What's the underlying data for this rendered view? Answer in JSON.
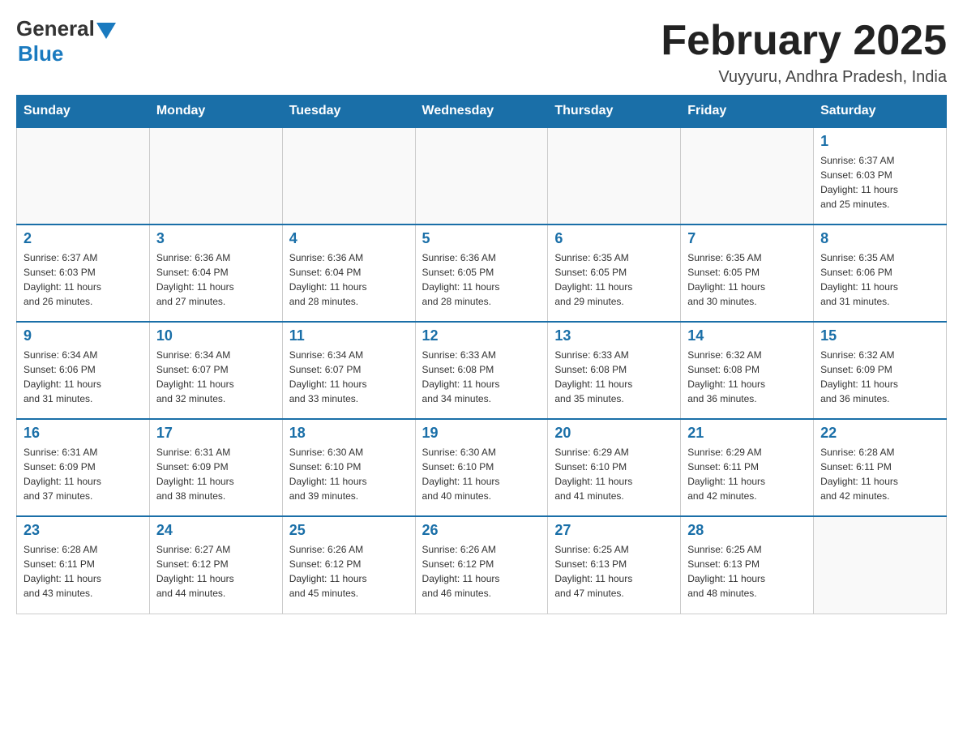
{
  "header": {
    "logo_general": "General",
    "logo_blue": "Blue",
    "title": "February 2025",
    "location": "Vuyyuru, Andhra Pradesh, India"
  },
  "weekdays": [
    "Sunday",
    "Monday",
    "Tuesday",
    "Wednesday",
    "Thursday",
    "Friday",
    "Saturday"
  ],
  "weeks": [
    [
      {
        "day": "",
        "info": ""
      },
      {
        "day": "",
        "info": ""
      },
      {
        "day": "",
        "info": ""
      },
      {
        "day": "",
        "info": ""
      },
      {
        "day": "",
        "info": ""
      },
      {
        "day": "",
        "info": ""
      },
      {
        "day": "1",
        "info": "Sunrise: 6:37 AM\nSunset: 6:03 PM\nDaylight: 11 hours\nand 25 minutes."
      }
    ],
    [
      {
        "day": "2",
        "info": "Sunrise: 6:37 AM\nSunset: 6:03 PM\nDaylight: 11 hours\nand 26 minutes."
      },
      {
        "day": "3",
        "info": "Sunrise: 6:36 AM\nSunset: 6:04 PM\nDaylight: 11 hours\nand 27 minutes."
      },
      {
        "day": "4",
        "info": "Sunrise: 6:36 AM\nSunset: 6:04 PM\nDaylight: 11 hours\nand 28 minutes."
      },
      {
        "day": "5",
        "info": "Sunrise: 6:36 AM\nSunset: 6:05 PM\nDaylight: 11 hours\nand 28 minutes."
      },
      {
        "day": "6",
        "info": "Sunrise: 6:35 AM\nSunset: 6:05 PM\nDaylight: 11 hours\nand 29 minutes."
      },
      {
        "day": "7",
        "info": "Sunrise: 6:35 AM\nSunset: 6:05 PM\nDaylight: 11 hours\nand 30 minutes."
      },
      {
        "day": "8",
        "info": "Sunrise: 6:35 AM\nSunset: 6:06 PM\nDaylight: 11 hours\nand 31 minutes."
      }
    ],
    [
      {
        "day": "9",
        "info": "Sunrise: 6:34 AM\nSunset: 6:06 PM\nDaylight: 11 hours\nand 31 minutes."
      },
      {
        "day": "10",
        "info": "Sunrise: 6:34 AM\nSunset: 6:07 PM\nDaylight: 11 hours\nand 32 minutes."
      },
      {
        "day": "11",
        "info": "Sunrise: 6:34 AM\nSunset: 6:07 PM\nDaylight: 11 hours\nand 33 minutes."
      },
      {
        "day": "12",
        "info": "Sunrise: 6:33 AM\nSunset: 6:08 PM\nDaylight: 11 hours\nand 34 minutes."
      },
      {
        "day": "13",
        "info": "Sunrise: 6:33 AM\nSunset: 6:08 PM\nDaylight: 11 hours\nand 35 minutes."
      },
      {
        "day": "14",
        "info": "Sunrise: 6:32 AM\nSunset: 6:08 PM\nDaylight: 11 hours\nand 36 minutes."
      },
      {
        "day": "15",
        "info": "Sunrise: 6:32 AM\nSunset: 6:09 PM\nDaylight: 11 hours\nand 36 minutes."
      }
    ],
    [
      {
        "day": "16",
        "info": "Sunrise: 6:31 AM\nSunset: 6:09 PM\nDaylight: 11 hours\nand 37 minutes."
      },
      {
        "day": "17",
        "info": "Sunrise: 6:31 AM\nSunset: 6:09 PM\nDaylight: 11 hours\nand 38 minutes."
      },
      {
        "day": "18",
        "info": "Sunrise: 6:30 AM\nSunset: 6:10 PM\nDaylight: 11 hours\nand 39 minutes."
      },
      {
        "day": "19",
        "info": "Sunrise: 6:30 AM\nSunset: 6:10 PM\nDaylight: 11 hours\nand 40 minutes."
      },
      {
        "day": "20",
        "info": "Sunrise: 6:29 AM\nSunset: 6:10 PM\nDaylight: 11 hours\nand 41 minutes."
      },
      {
        "day": "21",
        "info": "Sunrise: 6:29 AM\nSunset: 6:11 PM\nDaylight: 11 hours\nand 42 minutes."
      },
      {
        "day": "22",
        "info": "Sunrise: 6:28 AM\nSunset: 6:11 PM\nDaylight: 11 hours\nand 42 minutes."
      }
    ],
    [
      {
        "day": "23",
        "info": "Sunrise: 6:28 AM\nSunset: 6:11 PM\nDaylight: 11 hours\nand 43 minutes."
      },
      {
        "day": "24",
        "info": "Sunrise: 6:27 AM\nSunset: 6:12 PM\nDaylight: 11 hours\nand 44 minutes."
      },
      {
        "day": "25",
        "info": "Sunrise: 6:26 AM\nSunset: 6:12 PM\nDaylight: 11 hours\nand 45 minutes."
      },
      {
        "day": "26",
        "info": "Sunrise: 6:26 AM\nSunset: 6:12 PM\nDaylight: 11 hours\nand 46 minutes."
      },
      {
        "day": "27",
        "info": "Sunrise: 6:25 AM\nSunset: 6:13 PM\nDaylight: 11 hours\nand 47 minutes."
      },
      {
        "day": "28",
        "info": "Sunrise: 6:25 AM\nSunset: 6:13 PM\nDaylight: 11 hours\nand 48 minutes."
      },
      {
        "day": "",
        "info": ""
      }
    ]
  ]
}
